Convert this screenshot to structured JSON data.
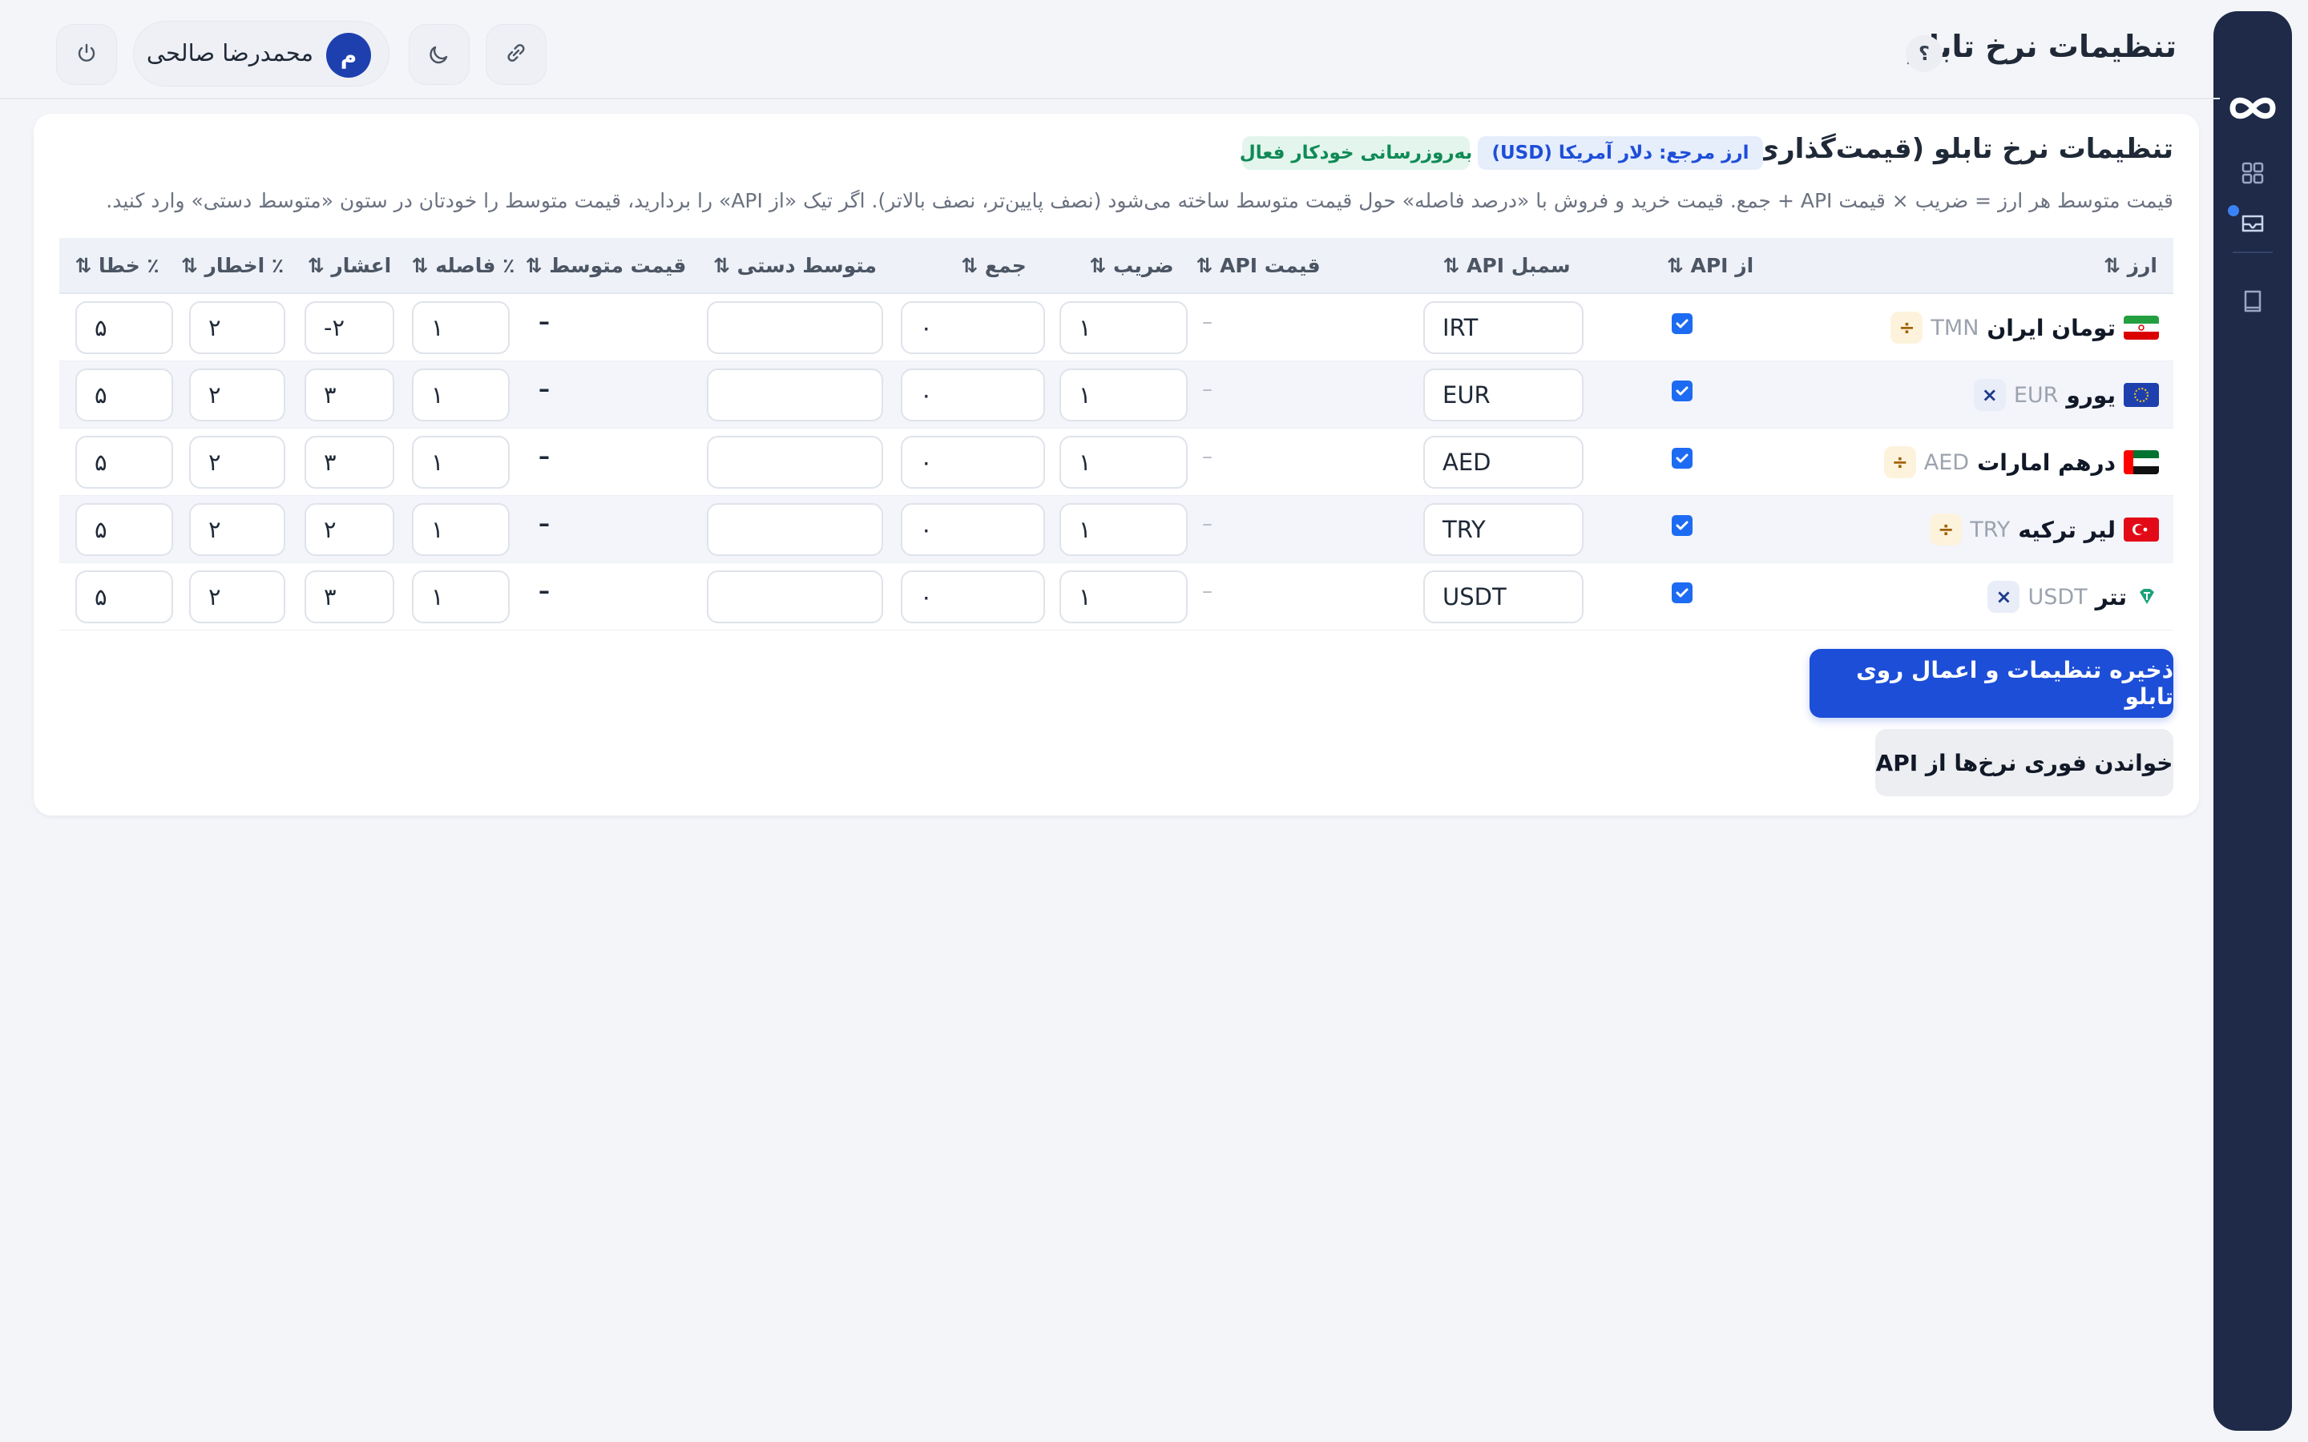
{
  "header": {
    "title": "تنظیمات نرخ تابلو",
    "help_label": "؟",
    "user_name": "محمدرضا صالحی",
    "user_initial": "م"
  },
  "sidebar": {
    "icons": [
      "infinity-logo",
      "grid-icon",
      "inbox-icon",
      "book-icon"
    ]
  },
  "card": {
    "title": "تنظیمات نرخ تابلو (قیمت‌گذاری خودکار)",
    "badge_reference": "ارز مرجع: دلار آمریکا (USD)",
    "badge_auto": "به‌روزرسانی خودکار فعال",
    "description": "قیمت متوسط هر ارز = ضریب × قیمت API + جمع. قیمت خرید و فروش با «درصد فاصله» حول قیمت متوسط ساخته می‌شود (نصف پایین‌تر، نصف بالاتر). اگر تیک «از API» را بردارید، قیمت متوسط را خودتان در ستون «متوسط دستی» وارد کنید."
  },
  "table": {
    "headers": {
      "currency": "ارز ⇅",
      "from_api": "از API ⇅",
      "api_symbol": "سمبل API ⇅",
      "api_price": "قیمت API ⇅",
      "multiplier": "ضریب ⇅",
      "addition": "جمع ⇅",
      "manual_avg": "متوسط دستی ⇅",
      "avg_price": "قیمت متوسط ⇅",
      "spread": "٪ فاصله ⇅",
      "decimals": "اعشار ⇅",
      "warning": "٪ اخطار ⇅",
      "error": "٪ خطا ⇅"
    },
    "rows": [
      {
        "name": "تومان ایران",
        "code": "TMN",
        "op": "÷",
        "op_type": "div",
        "flag": "iran-flag",
        "from_api": true,
        "symbol": "IRT",
        "api_price": "–",
        "multiplier": "۱",
        "addition": "۰",
        "manual_avg": "",
        "avg_price": "–",
        "spread": "۱",
        "decimals": "-۲",
        "warning": "۲",
        "error": "۵"
      },
      {
        "name": "یورو",
        "code": "EUR",
        "op": "×",
        "op_type": "mul",
        "flag": "eu-flag",
        "from_api": true,
        "symbol": "EUR",
        "api_price": "–",
        "multiplier": "۱",
        "addition": "۰",
        "manual_avg": "",
        "avg_price": "–",
        "spread": "۱",
        "decimals": "۳",
        "warning": "۲",
        "error": "۵"
      },
      {
        "name": "درهم امارات",
        "code": "AED",
        "op": "÷",
        "op_type": "div",
        "flag": "uae-flag",
        "from_api": true,
        "symbol": "AED",
        "api_price": "–",
        "multiplier": "۱",
        "addition": "۰",
        "manual_avg": "",
        "avg_price": "–",
        "spread": "۱",
        "decimals": "۳",
        "warning": "۲",
        "error": "۵"
      },
      {
        "name": "لیر ترکیه",
        "code": "TRY",
        "op": "÷",
        "op_type": "div",
        "flag": "turkey-flag",
        "from_api": true,
        "symbol": "TRY",
        "api_price": "–",
        "multiplier": "۱",
        "addition": "۰",
        "manual_avg": "",
        "avg_price": "–",
        "spread": "۱",
        "decimals": "۲",
        "warning": "۲",
        "error": "۵"
      },
      {
        "name": "تتر",
        "code": "USDT",
        "op": "×",
        "op_type": "mul",
        "flag": "tether-icon",
        "from_api": true,
        "symbol": "USDT",
        "api_price": "–",
        "multiplier": "۱",
        "addition": "۰",
        "manual_avg": "",
        "avg_price": "–",
        "spread": "۱",
        "decimals": "۳",
        "warning": "۲",
        "error": "۵"
      }
    ]
  },
  "actions": {
    "save_label": "ذخیره تنظیمات و اعمال روی تابلو",
    "fetch_label": "خواندن فوری نرخ‌ها از API"
  },
  "colors": {
    "primary": "#1d4ed8",
    "sidebar": "#1e2a48",
    "badge_ref_bg": "#e6edfb",
    "badge_auto_bg": "#e3f5ec",
    "badge_auto_text": "#0f8a56"
  }
}
